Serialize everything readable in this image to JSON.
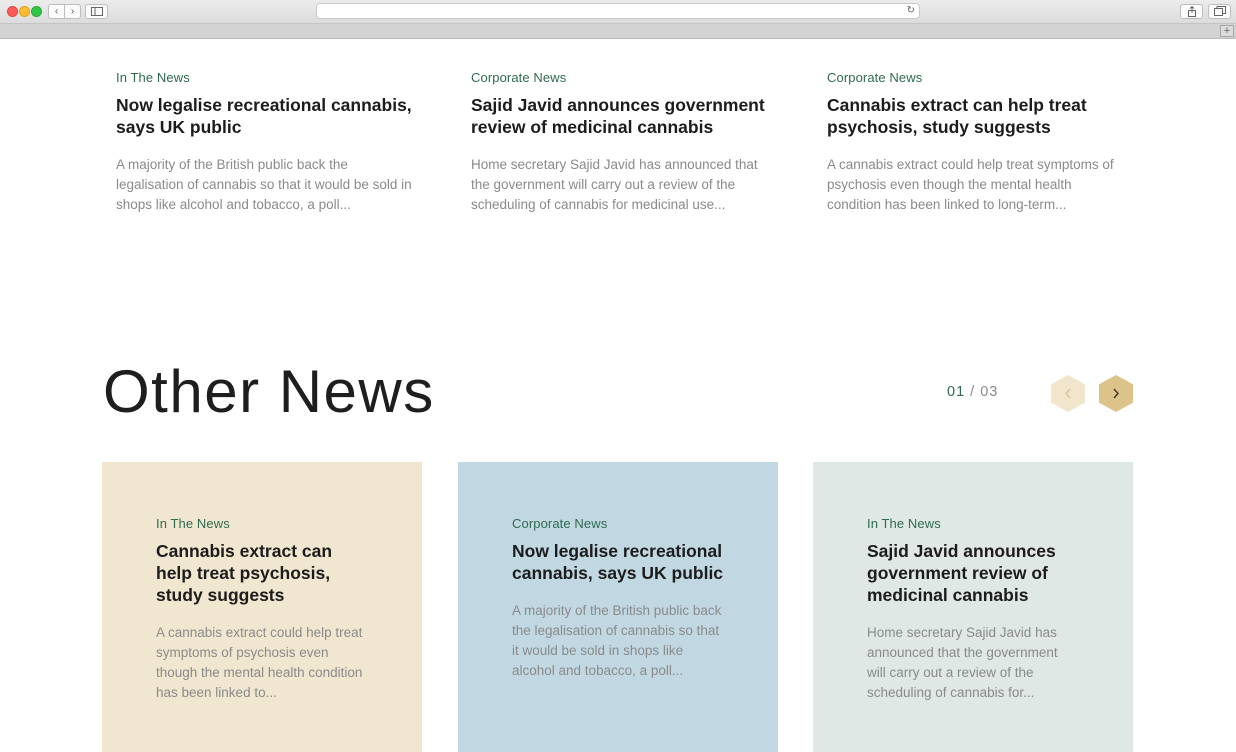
{
  "browser": {
    "back_icon": "chevron-left-icon",
    "forward_icon": "chevron-right-icon",
    "sidebar_icon": "sidebar-icon",
    "reload_icon": "reload-icon",
    "share_icon": "share-icon",
    "tabs_icon": "tabs-icon",
    "new_tab_icon": "plus-icon"
  },
  "top_news": [
    {
      "category": "In The News",
      "title": "Now legalise recreational cannabis, says UK public",
      "excerpt": "A majority of the British public back the legalisation of cannabis so that it would be sold in shops like alcohol and tobacco, a poll..."
    },
    {
      "category": "Corporate News",
      "title": "Sajid Javid announces government review of medicinal cannabis",
      "excerpt": "Home secretary Sajid Javid has announced that the government will carry out a review of the scheduling of cannabis for medicinal use..."
    },
    {
      "category": "Corporate News",
      "title": "Cannabis extract can help treat psychosis, study suggests",
      "excerpt": "A cannabis extract could help treat symptoms of psychosis even though the mental health condition has been linked to long-term..."
    }
  ],
  "other_news": {
    "heading": "Other News",
    "pager": {
      "current": "01",
      "separator": "/",
      "total": "03"
    },
    "prev_icon": "chevron-left-icon",
    "next_icon": "chevron-right-icon",
    "cards": [
      {
        "category": "In The News",
        "title": "Cannabis extract can help treat psychosis, study suggests",
        "excerpt": "A cannabis extract could help treat symptoms of psychosis even though the mental health condition has been linked to...",
        "color": "#f1e6cf"
      },
      {
        "category": "Corporate News",
        "title": "Now legalise recreational cannabis, says UK public",
        "excerpt": "A majority of the British public back the legalisation of cannabis so that it would be sold in shops like alcohol and tobacco, a poll...",
        "color": "#c1d8e3"
      },
      {
        "category": "In The News",
        "title": "Sajid Javid announces government review of medicinal cannabis",
        "excerpt": "Home secretary Sajid Javid has announced that the government will carry out a review of the scheduling of cannabis for...",
        "color": "#dfe8e4"
      }
    ]
  },
  "colors": {
    "category_green": "#2f6b4f",
    "accent_gold": "#dcc38a",
    "accent_gold_light": "#f1e6cc"
  }
}
